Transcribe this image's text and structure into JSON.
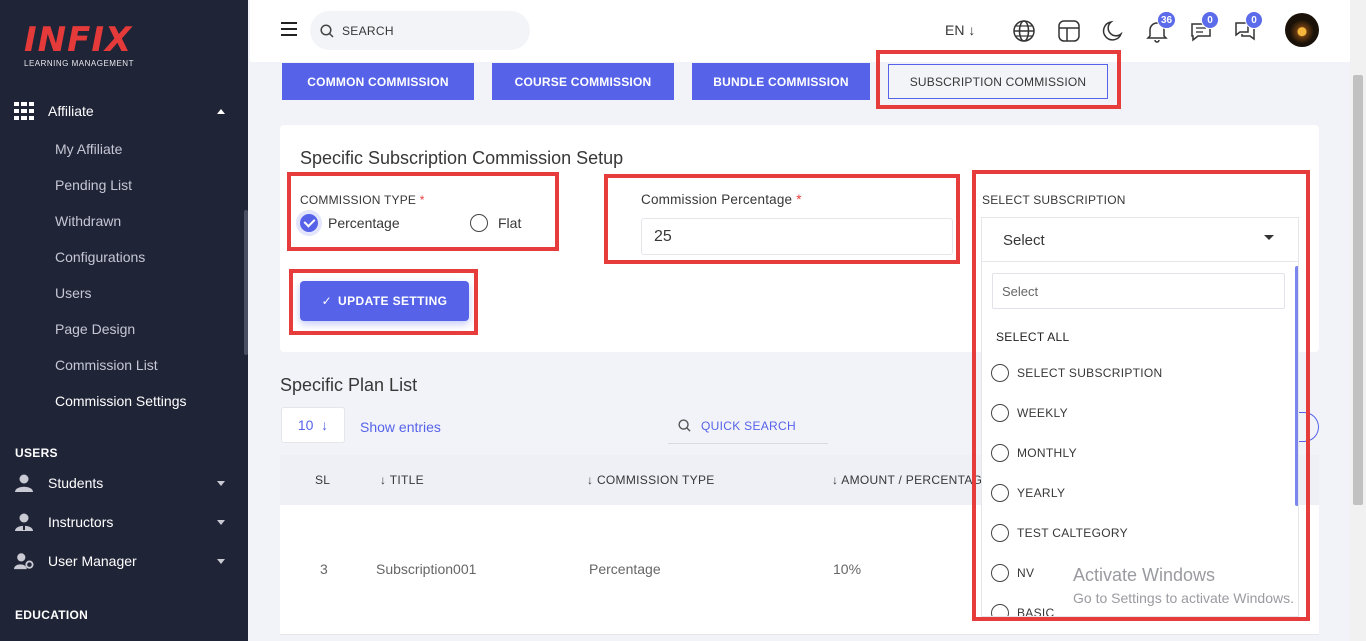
{
  "brand": {
    "logo": "INFIX",
    "tagline": "LEARNING MANAGEMENT"
  },
  "sidebar": {
    "affiliate": {
      "label": "Affiliate",
      "items": [
        "My Affiliate",
        "Pending List",
        "Withdrawn",
        "Configurations",
        "Users",
        "Page Design",
        "Commission List",
        "Commission Settings"
      ],
      "active": "Commission Settings"
    },
    "users_section": "USERS",
    "users_items": [
      "Students",
      "Instructors",
      "User Manager"
    ],
    "education_section": "EDUCATION"
  },
  "topbar": {
    "search_placeholder": "SEARCH",
    "language": "EN",
    "notifications_count": "36",
    "messages_count": "0",
    "chat_count": "0"
  },
  "tabs": [
    "COMMON COMMISSION",
    "COURSE COMMISSION",
    "BUNDLE COMMISSION",
    "SUBSCRIPTION COMMISSION"
  ],
  "selected_tab": "SUBSCRIPTION COMMISSION",
  "setup": {
    "title": "Specific Subscription Commission Setup",
    "commission_type_label": "COMMISSION TYPE",
    "required_mark": "*",
    "type_options": [
      "Percentage",
      "Flat"
    ],
    "type_selected": "Percentage",
    "percentage_label": "Commission Percentage",
    "percentage_value": "25",
    "update_button": "UPDATE SETTING",
    "select_label": "SELECT SUBSCRIPTION",
    "select_value": "Select"
  },
  "dropdown": {
    "search_placeholder": "Select",
    "select_all": "SELECT ALL",
    "options": [
      "SELECT SUBSCRIPTION",
      "WEEKLY",
      "MONTHLY",
      "YEARLY",
      "TEST CALTEGORY",
      "NV",
      "BASIC"
    ]
  },
  "plan_list": {
    "title": "Specific Plan List",
    "entries_value": "10",
    "show_entries": "Show entries",
    "quick_search": "QUICK SEARCH",
    "columns": [
      "SL",
      "TITLE",
      "COMMISSION TYPE",
      "AMOUNT / PERCENTAGE"
    ],
    "rows": [
      {
        "sl": "3",
        "title": "Subscription001",
        "type": "Percentage",
        "amount": "10%"
      }
    ]
  },
  "watermark": {
    "line1": "Activate Windows",
    "line2": "Go to Settings to activate Windows."
  },
  "colors": {
    "accent": "#5663e9",
    "sidebar_bg": "#202437",
    "highlight_box": "#e73c3c",
    "logo": "#e53a3a"
  }
}
